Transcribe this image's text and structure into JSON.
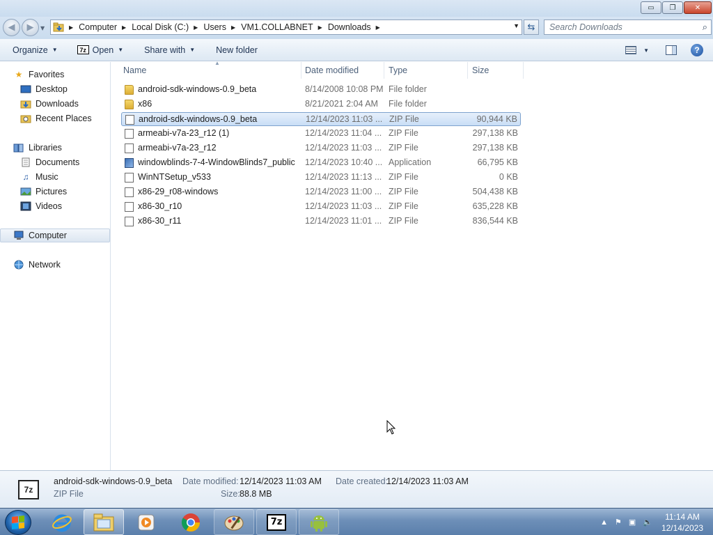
{
  "window": {
    "minimize_glyph": "▭",
    "maximize_glyph": "❐",
    "close_glyph": "✕"
  },
  "address": {
    "crumbs": [
      "Computer",
      "Local Disk (C:)",
      "Users",
      "VM1.COLLABNET",
      "Downloads"
    ],
    "search_placeholder": "Search Downloads"
  },
  "toolbar": {
    "organize": "Organize",
    "open": "Open",
    "open_icon": "7z",
    "share_with": "Share with",
    "new_folder": "New folder"
  },
  "nav": {
    "favorites": "Favorites",
    "desktop": "Desktop",
    "downloads": "Downloads",
    "recent_places": "Recent Places",
    "libraries": "Libraries",
    "documents": "Documents",
    "music": "Music",
    "pictures": "Pictures",
    "videos": "Videos",
    "computer": "Computer",
    "network": "Network"
  },
  "columns": {
    "name": "Name",
    "date_modified": "Date modified",
    "type": "Type",
    "size": "Size"
  },
  "files": [
    {
      "name": "android-sdk-windows-0.9_beta",
      "date": "8/14/2008 10:08 PM",
      "type": "File folder",
      "size": "",
      "icon": "folder-icon"
    },
    {
      "name": "x86",
      "date": "8/21/2021 2:04 AM",
      "type": "File folder",
      "size": "",
      "icon": "folder-icon"
    },
    {
      "name": "android-sdk-windows-0.9_beta",
      "date": "12/14/2023 11:03 ...",
      "type": "ZIP File",
      "size": "90,944 KB",
      "icon": "zip-file-icon",
      "selected": true
    },
    {
      "name": "armeabi-v7a-23_r12 (1)",
      "date": "12/14/2023 11:04 ...",
      "type": "ZIP File",
      "size": "297,138 KB",
      "icon": "zip-file-icon"
    },
    {
      "name": "armeabi-v7a-23_r12",
      "date": "12/14/2023 11:03 ...",
      "type": "ZIP File",
      "size": "297,138 KB",
      "icon": "zip-file-icon"
    },
    {
      "name": "windowblinds-7-4-WindowBlinds7_public",
      "date": "12/14/2023 10:40 ...",
      "type": "Application",
      "size": "66,795 KB",
      "icon": "application-icon"
    },
    {
      "name": "WinNTSetup_v533",
      "date": "12/14/2023 11:13 ...",
      "type": "ZIP File",
      "size": "0 KB",
      "icon": "zip-file-icon"
    },
    {
      "name": "x86-29_r08-windows",
      "date": "12/14/2023 11:00 ...",
      "type": "ZIP File",
      "size": "504,438 KB",
      "icon": "zip-file-icon"
    },
    {
      "name": "x86-30_r10",
      "date": "12/14/2023 11:03 ...",
      "type": "ZIP File",
      "size": "635,228 KB",
      "icon": "zip-file-icon"
    },
    {
      "name": "x86-30_r11",
      "date": "12/14/2023 11:01 ...",
      "type": "ZIP File",
      "size": "836,544 KB",
      "icon": "zip-file-icon"
    }
  ],
  "details": {
    "icon_text": "7z",
    "name": "android-sdk-windows-0.9_beta",
    "type": "ZIP File",
    "date_modified_label": "Date modified:",
    "date_modified": "12/14/2023 11:03 AM",
    "date_created_label": "Date created:",
    "date_created": "12/14/2023 11:03 AM",
    "size_label": "Size:",
    "size": "88.8 MB"
  },
  "taskbar": {
    "time": "11:14 AM",
    "date": "12/14/2023",
    "sevenzip_label": "7z"
  }
}
